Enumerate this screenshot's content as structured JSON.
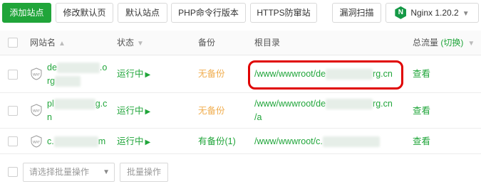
{
  "toolbar": {
    "add_site": "添加站点",
    "modify_default_page": "修改默认页",
    "default_site": "默认站点",
    "php_cli_version": "PHP命令行版本",
    "https_protect": "HTTPS防窜站",
    "vuln_scan": "漏洞扫描",
    "nginx_version": "Nginx 1.20.2",
    "nginx_icon": "nginx-logo-icon"
  },
  "table": {
    "headers": {
      "site_name": "网站名",
      "status": "状态",
      "backup": "备份",
      "root_dir": "根目录",
      "traffic": "总流量",
      "switch": "(切换)"
    },
    "rows": [
      {
        "name_line1": "de",
        "name_line1_tail": ".o",
        "name_line2": "rg",
        "status": "运行中",
        "backup": "无备份",
        "root_line1": "/www/wwwroot/de",
        "root_line1_tail": "rg.cn",
        "root_line2": "",
        "action": "查看"
      },
      {
        "name_line1": "pl",
        "name_line1_tail": "g.c",
        "name_line2": "n",
        "status": "运行中",
        "backup": "无备份",
        "root_line1": "/www/wwwroot/de",
        "root_line1_tail": "rg.cn",
        "root_line2": "/a",
        "action": "查看"
      },
      {
        "name_line1": "c.",
        "name_line1_tail": "m",
        "name_line2": "",
        "status": "运行中",
        "backup": "有备份(1)",
        "root_line1": "/www/wwwroot/c.",
        "root_line1_tail": "",
        "root_line2": "",
        "action": "查看"
      }
    ],
    "waf_label": "WAF"
  },
  "footer": {
    "batch_select_placeholder": "请选择批量操作",
    "batch_button": "批量操作"
  },
  "colors": {
    "brand_green": "#20a53a",
    "warning_orange": "#f0ad4e",
    "highlight_red": "#e00000"
  }
}
